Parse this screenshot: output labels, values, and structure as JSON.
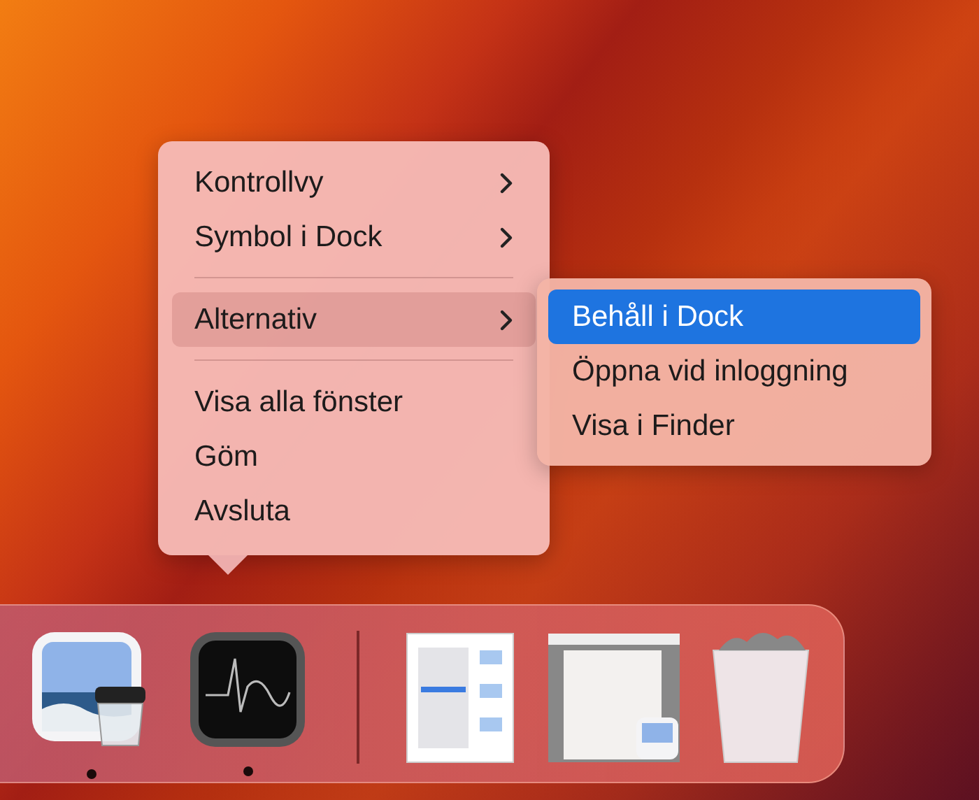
{
  "menu": {
    "items": [
      {
        "kind": "item",
        "label": "Kontrollvy",
        "has_submenu": true,
        "selected": false
      },
      {
        "kind": "item",
        "label": "Symbol i Dock",
        "has_submenu": true,
        "selected": false
      },
      {
        "kind": "separator"
      },
      {
        "kind": "item",
        "label": "Alternativ",
        "has_submenu": true,
        "selected": true
      },
      {
        "kind": "separator"
      },
      {
        "kind": "item",
        "label": "Visa alla fönster",
        "has_submenu": false,
        "selected": false
      },
      {
        "kind": "item",
        "label": "Göm",
        "has_submenu": false,
        "selected": false
      },
      {
        "kind": "item",
        "label": "Avsluta",
        "has_submenu": false,
        "selected": false
      }
    ]
  },
  "submenu": {
    "items": [
      {
        "label": "Behåll i Dock",
        "selected": true
      },
      {
        "label": "Öppna vid inloggning",
        "selected": false
      },
      {
        "label": "Visa i Finder",
        "selected": false
      }
    ]
  },
  "dock": {
    "items": [
      {
        "kind": "photo-app",
        "running": true
      },
      {
        "kind": "monitor-app",
        "running": true
      },
      {
        "kind": "divider"
      },
      {
        "kind": "document",
        "running": false
      },
      {
        "kind": "window",
        "running": false
      },
      {
        "kind": "trash",
        "running": false
      }
    ]
  }
}
